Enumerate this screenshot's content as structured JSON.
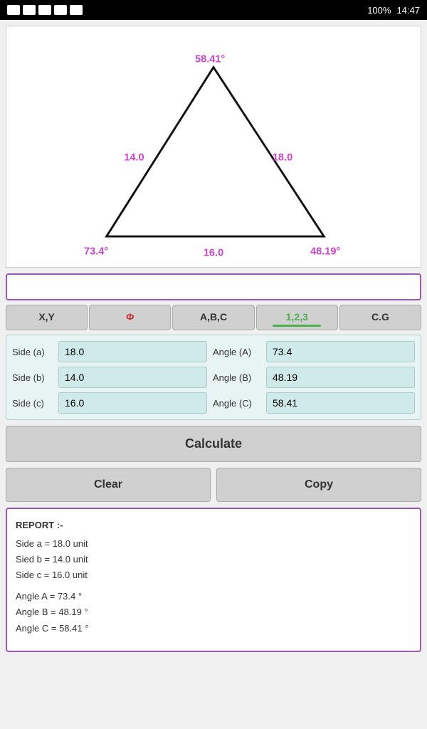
{
  "statusBar": {
    "battery": "100%",
    "time": "14:47"
  },
  "triangle": {
    "angleTop": "58.41°",
    "angleBottomLeft": "73.4°",
    "angleBottomRight": "48.19°",
    "sideLeft": "14.0",
    "sideRight": "18.0",
    "sideBottom": "16.0"
  },
  "tabs": [
    {
      "id": "xy",
      "label": "X,Y",
      "active": false
    },
    {
      "id": "phi",
      "label": "Φ",
      "active": false
    },
    {
      "id": "abc",
      "label": "A,B,C",
      "active": false
    },
    {
      "id": "123",
      "label": "1,2,3",
      "active": true
    },
    {
      "id": "cg",
      "label": "C.G",
      "active": false
    }
  ],
  "fields": {
    "sideA": {
      "label": "Side (a)",
      "value": "18.0"
    },
    "sideB": {
      "label": "Side (b)",
      "value": "14.0"
    },
    "sideC": {
      "label": "Side (c)",
      "value": "16.0"
    },
    "angleA": {
      "label": "Angle (A)",
      "value": "73.4"
    },
    "angleB": {
      "label": "Angle (B)",
      "value": "48.19"
    },
    "angleC": {
      "label": "Angle (C)",
      "value": "58.41"
    }
  },
  "buttons": {
    "calculate": "Calculate",
    "clear": "Clear",
    "copy": "Copy"
  },
  "report": {
    "title": "REPORT :-",
    "lines": [
      "Side a = 18.0 unit",
      "Sied b = 14.0 unit",
      "Side c = 16.0 unit",
      "",
      "Angle A = 73.4 °",
      "Angle B = 48.19 °",
      "Angle C = 58.41 °"
    ]
  }
}
